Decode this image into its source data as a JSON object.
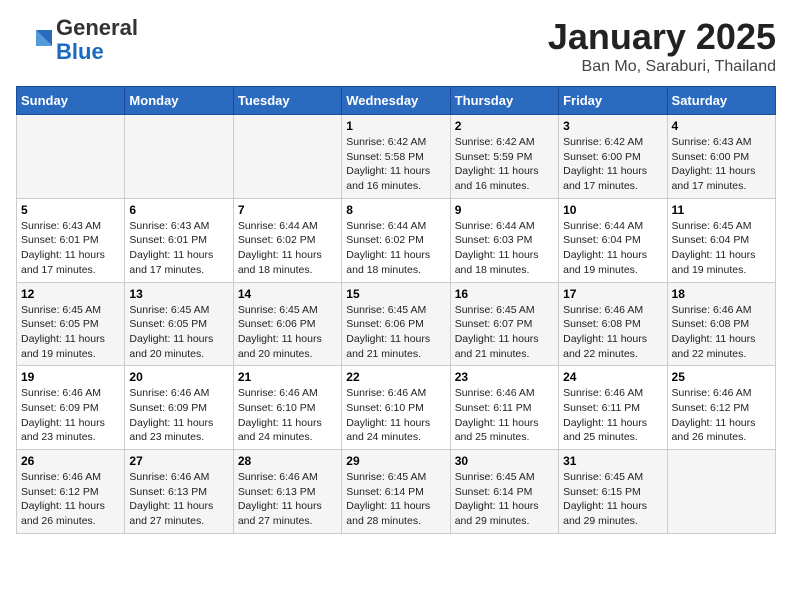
{
  "header": {
    "logo_general": "General",
    "logo_blue": "Blue",
    "month": "January 2025",
    "location": "Ban Mo, Saraburi, Thailand"
  },
  "weekdays": [
    "Sunday",
    "Monday",
    "Tuesday",
    "Wednesday",
    "Thursday",
    "Friday",
    "Saturday"
  ],
  "weeks": [
    [
      {
        "day": "",
        "info": ""
      },
      {
        "day": "",
        "info": ""
      },
      {
        "day": "",
        "info": ""
      },
      {
        "day": "1",
        "info": "Sunrise: 6:42 AM\nSunset: 5:58 PM\nDaylight: 11 hours and 16 minutes."
      },
      {
        "day": "2",
        "info": "Sunrise: 6:42 AM\nSunset: 5:59 PM\nDaylight: 11 hours and 16 minutes."
      },
      {
        "day": "3",
        "info": "Sunrise: 6:42 AM\nSunset: 6:00 PM\nDaylight: 11 hours and 17 minutes."
      },
      {
        "day": "4",
        "info": "Sunrise: 6:43 AM\nSunset: 6:00 PM\nDaylight: 11 hours and 17 minutes."
      }
    ],
    [
      {
        "day": "5",
        "info": "Sunrise: 6:43 AM\nSunset: 6:01 PM\nDaylight: 11 hours and 17 minutes."
      },
      {
        "day": "6",
        "info": "Sunrise: 6:43 AM\nSunset: 6:01 PM\nDaylight: 11 hours and 17 minutes."
      },
      {
        "day": "7",
        "info": "Sunrise: 6:44 AM\nSunset: 6:02 PM\nDaylight: 11 hours and 18 minutes."
      },
      {
        "day": "8",
        "info": "Sunrise: 6:44 AM\nSunset: 6:02 PM\nDaylight: 11 hours and 18 minutes."
      },
      {
        "day": "9",
        "info": "Sunrise: 6:44 AM\nSunset: 6:03 PM\nDaylight: 11 hours and 18 minutes."
      },
      {
        "day": "10",
        "info": "Sunrise: 6:44 AM\nSunset: 6:04 PM\nDaylight: 11 hours and 19 minutes."
      },
      {
        "day": "11",
        "info": "Sunrise: 6:45 AM\nSunset: 6:04 PM\nDaylight: 11 hours and 19 minutes."
      }
    ],
    [
      {
        "day": "12",
        "info": "Sunrise: 6:45 AM\nSunset: 6:05 PM\nDaylight: 11 hours and 19 minutes."
      },
      {
        "day": "13",
        "info": "Sunrise: 6:45 AM\nSunset: 6:05 PM\nDaylight: 11 hours and 20 minutes."
      },
      {
        "day": "14",
        "info": "Sunrise: 6:45 AM\nSunset: 6:06 PM\nDaylight: 11 hours and 20 minutes."
      },
      {
        "day": "15",
        "info": "Sunrise: 6:45 AM\nSunset: 6:06 PM\nDaylight: 11 hours and 21 minutes."
      },
      {
        "day": "16",
        "info": "Sunrise: 6:45 AM\nSunset: 6:07 PM\nDaylight: 11 hours and 21 minutes."
      },
      {
        "day": "17",
        "info": "Sunrise: 6:46 AM\nSunset: 6:08 PM\nDaylight: 11 hours and 22 minutes."
      },
      {
        "day": "18",
        "info": "Sunrise: 6:46 AM\nSunset: 6:08 PM\nDaylight: 11 hours and 22 minutes."
      }
    ],
    [
      {
        "day": "19",
        "info": "Sunrise: 6:46 AM\nSunset: 6:09 PM\nDaylight: 11 hours and 23 minutes."
      },
      {
        "day": "20",
        "info": "Sunrise: 6:46 AM\nSunset: 6:09 PM\nDaylight: 11 hours and 23 minutes."
      },
      {
        "day": "21",
        "info": "Sunrise: 6:46 AM\nSunset: 6:10 PM\nDaylight: 11 hours and 24 minutes."
      },
      {
        "day": "22",
        "info": "Sunrise: 6:46 AM\nSunset: 6:10 PM\nDaylight: 11 hours and 24 minutes."
      },
      {
        "day": "23",
        "info": "Sunrise: 6:46 AM\nSunset: 6:11 PM\nDaylight: 11 hours and 25 minutes."
      },
      {
        "day": "24",
        "info": "Sunrise: 6:46 AM\nSunset: 6:11 PM\nDaylight: 11 hours and 25 minutes."
      },
      {
        "day": "25",
        "info": "Sunrise: 6:46 AM\nSunset: 6:12 PM\nDaylight: 11 hours and 26 minutes."
      }
    ],
    [
      {
        "day": "26",
        "info": "Sunrise: 6:46 AM\nSunset: 6:12 PM\nDaylight: 11 hours and 26 minutes."
      },
      {
        "day": "27",
        "info": "Sunrise: 6:46 AM\nSunset: 6:13 PM\nDaylight: 11 hours and 27 minutes."
      },
      {
        "day": "28",
        "info": "Sunrise: 6:46 AM\nSunset: 6:13 PM\nDaylight: 11 hours and 27 minutes."
      },
      {
        "day": "29",
        "info": "Sunrise: 6:45 AM\nSunset: 6:14 PM\nDaylight: 11 hours and 28 minutes."
      },
      {
        "day": "30",
        "info": "Sunrise: 6:45 AM\nSunset: 6:14 PM\nDaylight: 11 hours and 29 minutes."
      },
      {
        "day": "31",
        "info": "Sunrise: 6:45 AM\nSunset: 6:15 PM\nDaylight: 11 hours and 29 minutes."
      },
      {
        "day": "",
        "info": ""
      }
    ]
  ]
}
